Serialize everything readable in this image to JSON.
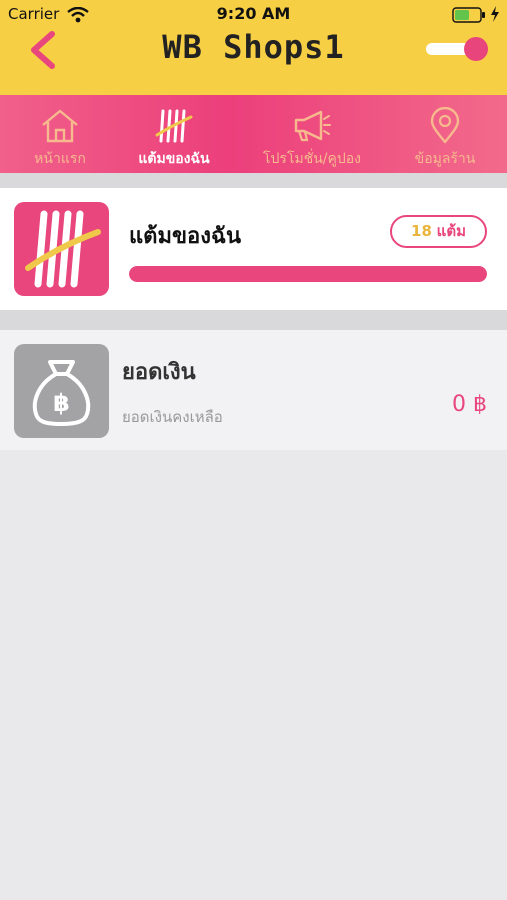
{
  "status_bar": {
    "carrier": "Carrier",
    "time": "9:20 AM"
  },
  "header": {
    "title": "WB Shops1",
    "toggle_on": true
  },
  "tabs": [
    {
      "label": "หน้าแรก",
      "icon": "home-icon",
      "active": false
    },
    {
      "label": "แต้มของฉัน",
      "icon": "points-tally-icon",
      "active": true
    },
    {
      "label": "โปรโมชั่น/คูปอง",
      "icon": "megaphone-icon",
      "active": false
    },
    {
      "label": "ข้อมูลร้าน",
      "icon": "location-pin-icon",
      "active": false
    }
  ],
  "points_card": {
    "title": "แต้มของฉัน",
    "points": "18",
    "unit": "แต้ม",
    "progress": 1.0
  },
  "balance": {
    "title": "ยอดเงิน",
    "subtitle": "ยอดเงินคงเหลือ",
    "amount": "0 ฿"
  },
  "colors": {
    "header_bg": "#f7cf45",
    "accent": "#e8467c",
    "tab_inactive": "#f7b98e",
    "points_yellow": "#e9b53c"
  }
}
